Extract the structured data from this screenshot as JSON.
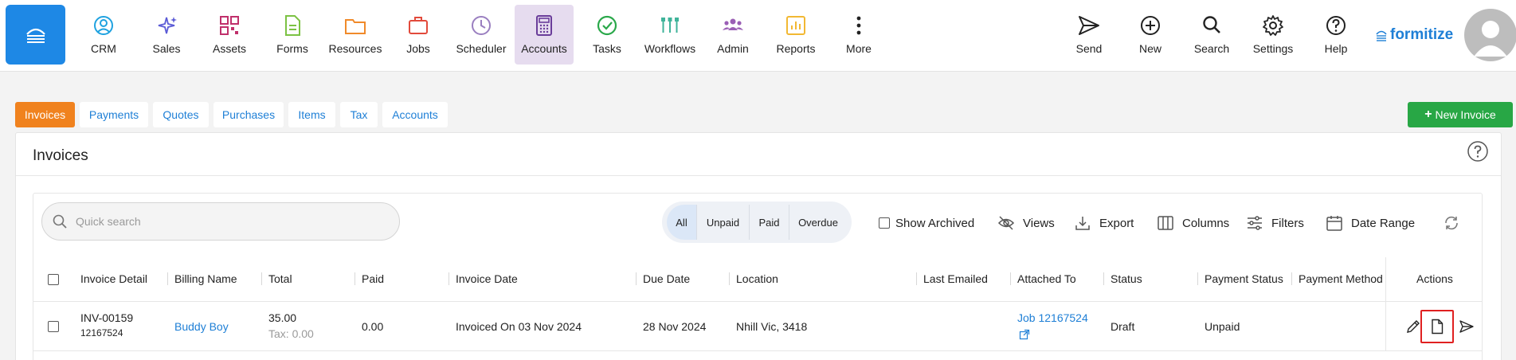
{
  "nav": {
    "items": [
      {
        "label": "CRM"
      },
      {
        "label": "Sales"
      },
      {
        "label": "Assets"
      },
      {
        "label": "Forms"
      },
      {
        "label": "Resources"
      },
      {
        "label": "Jobs"
      },
      {
        "label": "Scheduler"
      },
      {
        "label": "Accounts"
      },
      {
        "label": "Tasks"
      },
      {
        "label": "Workflows"
      },
      {
        "label": "Admin"
      },
      {
        "label": "Reports"
      },
      {
        "label": "More"
      }
    ],
    "right": [
      {
        "label": "Send"
      },
      {
        "label": "New"
      },
      {
        "label": "Search"
      },
      {
        "label": "Settings"
      },
      {
        "label": "Help"
      }
    ],
    "brand": "formitize",
    "active_color": "#e6dcef"
  },
  "tabs": [
    "Invoices",
    "Payments",
    "Quotes",
    "Purchases",
    "Items",
    "Tax",
    "Accounts"
  ],
  "new_invoice_label": "New Invoice",
  "panel": {
    "title": "Invoices"
  },
  "search": {
    "placeholder": "Quick search"
  },
  "filter": [
    "All",
    "Unpaid",
    "Paid",
    "Overdue"
  ],
  "tools": {
    "show_archived": "Show Archived",
    "views": "Views",
    "export": "Export",
    "columns": "Columns",
    "filters": "Filters",
    "date_range": "Date Range"
  },
  "table": {
    "headers": [
      "Invoice Detail",
      "Billing Name",
      "Total",
      "Paid",
      "Invoice Date",
      "Due Date",
      "Location",
      "Last Emailed",
      "Attached To",
      "Status",
      "Payment Status",
      "Payment Method",
      "Actions"
    ],
    "rows": [
      {
        "invoice_no": "INV-00159",
        "invoice_id": "12167524",
        "billing_name": "Buddy Boy",
        "total": "35.00",
        "tax": "Tax: 0.00",
        "paid": "0.00",
        "invoice_date": "Invoiced On 03 Nov 2024",
        "due_date": "28 Nov 2024",
        "location": "Nhill Vic, 3418",
        "last_emailed": "",
        "attached_to": "Job 12167524",
        "status": "Draft",
        "payment_status": "Unpaid",
        "payment_method": ""
      }
    ]
  },
  "colors": {
    "primary": "#1e88e5",
    "active_tab": "#f0821e",
    "new_button": "#28a745",
    "link": "#1e7fd6",
    "highlight": "#e02020"
  }
}
